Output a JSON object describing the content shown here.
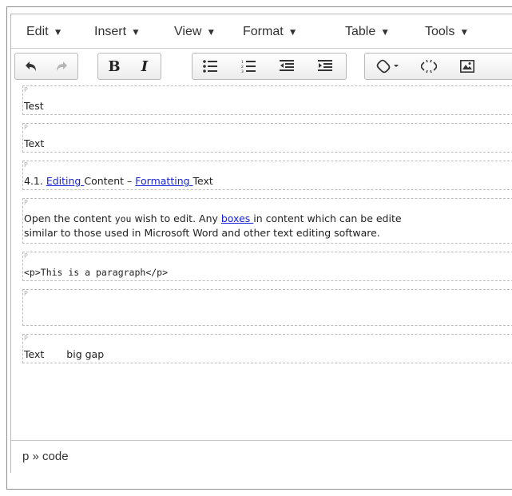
{
  "menubar": {
    "items": [
      {
        "label": "Edit"
      },
      {
        "label": "Insert"
      },
      {
        "label": "View"
      },
      {
        "label": "Format"
      },
      {
        "label": "Table"
      },
      {
        "label": "Tools"
      }
    ]
  },
  "toolbar": {
    "buttons": [
      "undo-icon",
      "redo-icon",
      "bold-icon",
      "italic-icon",
      "bullet-list-icon",
      "numbered-list-icon",
      "outdent-icon",
      "indent-icon",
      "link-icon",
      "unlink-icon",
      "image-icon"
    ],
    "bold_label": "B",
    "italic_label": "I"
  },
  "content": {
    "paragraph_tag": "P",
    "p1": "Test",
    "p2": "Text",
    "p3": {
      "prefix": "4.1. ",
      "link1": "Editing ",
      "middle": "Content – ",
      "link2": "Formatting ",
      "suffix": "Text"
    },
    "p4": {
      "line1_a": "Open the content ",
      "line1_code": "you",
      "line1_b": " wish to edit. Any ",
      "line1_link": "boxes ",
      "line1_c": "in content which can be edite",
      "line2": "similar to those used in Microsoft Word and other text editing software."
    },
    "p5": "<p>This is a paragraph</p>",
    "p6": "",
    "p7": {
      "a": "Text",
      "b": "big gap"
    }
  },
  "statusbar": {
    "path": "p » code"
  },
  "colors": {
    "link": "#1a24d8",
    "border": "#b9b9b9"
  }
}
